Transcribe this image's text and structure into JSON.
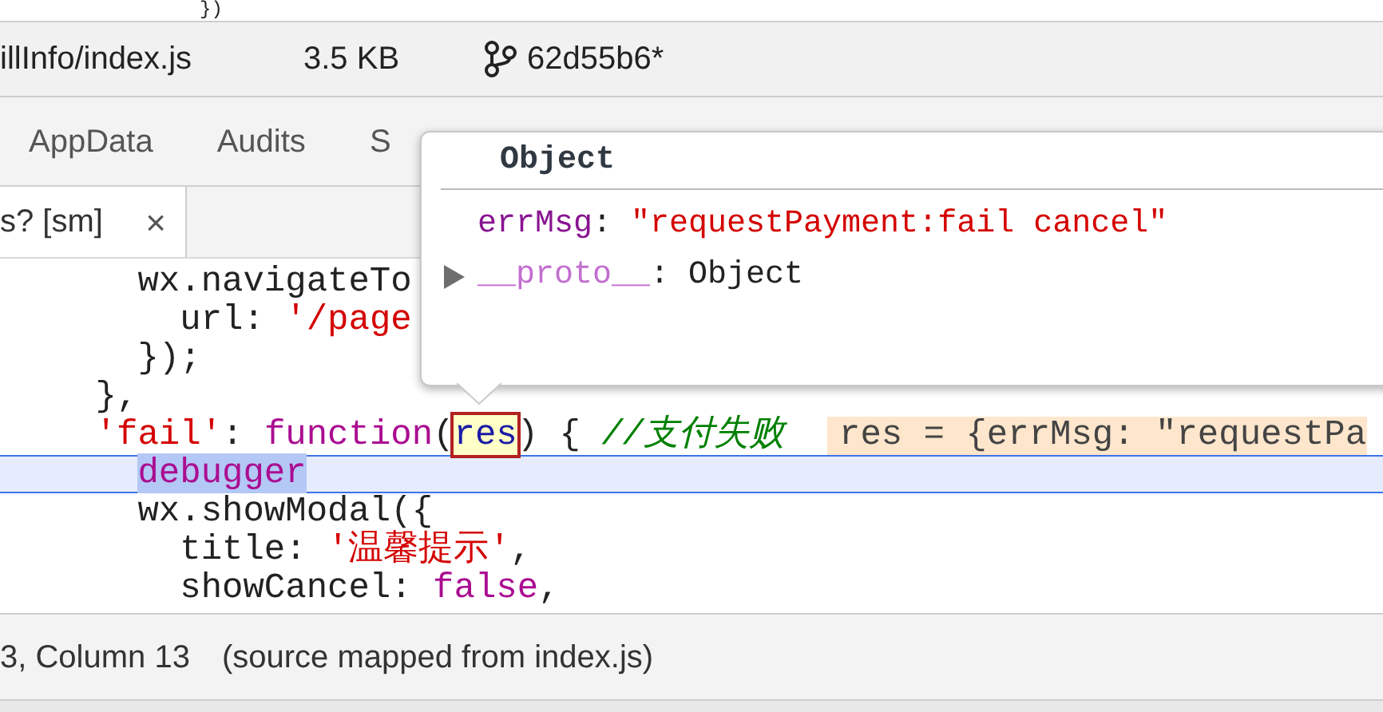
{
  "top_code": "})",
  "file_info": {
    "path": "illInfo/index.js",
    "size": "3.5 KB",
    "commit": "62d55b6*"
  },
  "panel_tabs": [
    {
      "label": "AppData",
      "selected": false
    },
    {
      "label": "Audits",
      "selected": false
    },
    {
      "label": "S",
      "selected": false
    }
  ],
  "file_tabs": [
    {
      "label": "s? [sm]",
      "selected": true,
      "close": "×"
    }
  ],
  "code_lines": [
    {
      "paused": false,
      "tokens": [
        {
          "kind": "plain",
          "text": "      wx.navigateTo"
        }
      ]
    },
    {
      "paused": false,
      "tokens": [
        {
          "kind": "plain",
          "text": "        url: "
        },
        {
          "kind": "string",
          "text": "'/page"
        }
      ]
    },
    {
      "paused": false,
      "tokens": [
        {
          "kind": "plain",
          "text": "      });"
        }
      ]
    },
    {
      "paused": false,
      "tokens": [
        {
          "kind": "plain",
          "text": "    },"
        }
      ]
    },
    {
      "paused": false,
      "tokens": [
        {
          "kind": "string",
          "text": "    'fail'"
        },
        {
          "kind": "plain",
          "text": ": "
        },
        {
          "kind": "keyword",
          "text": "function"
        },
        {
          "kind": "plain",
          "text": "("
        },
        {
          "kind": "hovered",
          "text": "res"
        },
        {
          "kind": "plain",
          "text": ") { "
        },
        {
          "kind": "comment",
          "text": "//支付失败  "
        },
        {
          "kind": "inline_value",
          "text": "res = {errMsg: \"requestPa"
        }
      ]
    },
    {
      "paused": true,
      "tokens": [
        {
          "kind": "selected_keyword",
          "text": "      debugger"
        }
      ]
    },
    {
      "paused": false,
      "tokens": [
        {
          "kind": "plain",
          "text": "      wx.showModal({"
        }
      ]
    },
    {
      "paused": false,
      "tokens": [
        {
          "kind": "plain",
          "text": "        title: "
        },
        {
          "kind": "string",
          "text": "'温馨提示'"
        },
        {
          "kind": "plain",
          "text": ","
        }
      ]
    },
    {
      "paused": false,
      "tokens": [
        {
          "kind": "plain",
          "text": "        showCancel: "
        },
        {
          "kind": "keyword",
          "text": "false"
        },
        {
          "kind": "plain",
          "text": ","
        }
      ]
    }
  ],
  "popover": {
    "title": "Object",
    "properties": [
      {
        "key": "errMsg",
        "colon": ":",
        "value": "\"requestPayment:fail cancel\"",
        "kind": "string",
        "expandable": false
      },
      {
        "key": "__proto__",
        "colon": ":",
        "value": "Object",
        "kind": "object",
        "expandable": true
      }
    ]
  },
  "status_bar": {
    "position": "3, Column 13",
    "note": "(source mapped from index.js)"
  }
}
